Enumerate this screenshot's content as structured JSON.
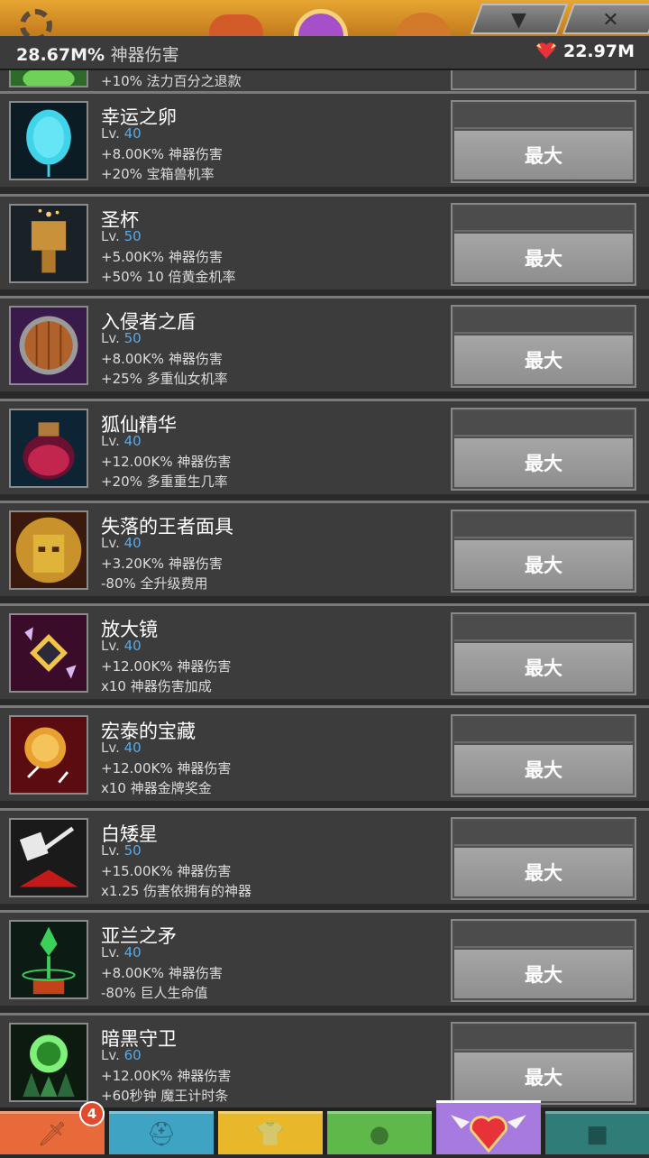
{
  "header": {
    "damage_value": "28.67M%",
    "damage_label": "神器伤害",
    "relics_value": "22.97M"
  },
  "top_tabs": {
    "collapse_icon": "down-triangle-icon",
    "close_icon": "close-icon"
  },
  "partial_row": {
    "effect2": "+10% 法力百分之退款"
  },
  "artifacts": [
    {
      "name": "幸运之卵",
      "lv_label": "Lv.",
      "lv": "40",
      "effect1": "+8.00K% 神器伤害",
      "effect2": "+20% 宝箱兽机率",
      "button": "最大",
      "icon": "egg-icon"
    },
    {
      "name": "圣杯",
      "lv_label": "Lv.",
      "lv": "50",
      "effect1": "+5.00K% 神器伤害",
      "effect2": "+50% 10 倍黄金机率",
      "button": "最大",
      "icon": "grail-icon"
    },
    {
      "name": "入侵者之盾",
      "lv_label": "Lv.",
      "lv": "50",
      "effect1": "+8.00K% 神器伤害",
      "effect2": "+25% 多重仙女机率",
      "button": "最大",
      "icon": "shield-icon"
    },
    {
      "name": "狐仙精华",
      "lv_label": "Lv.",
      "lv": "40",
      "effect1": "+12.00K% 神器伤害",
      "effect2": "+20% 多重重生几率",
      "button": "最大",
      "icon": "potion-icon"
    },
    {
      "name": "失落的王者面具",
      "lv_label": "Lv.",
      "lv": "40",
      "effect1": "+3.20K% 神器伤害",
      "effect2": "-80% 全升级费用",
      "button": "最大",
      "icon": "mask-icon"
    },
    {
      "name": "放大镜",
      "lv_label": "Lv.",
      "lv": "40",
      "effect1": "+12.00K% 神器伤害",
      "effect2": "x10 神器伤害加成",
      "button": "最大",
      "icon": "gem-icon"
    },
    {
      "name": "宏泰的宝藏",
      "lv_label": "Lv.",
      "lv": "40",
      "effect1": "+12.00K% 神器伤害",
      "effect2": "x10 神器金牌奖金",
      "button": "最大",
      "icon": "coin-icon"
    },
    {
      "name": "白矮星",
      "lv_label": "Lv.",
      "lv": "50",
      "effect1": "+15.00K% 神器伤害",
      "effect2": "x1.25 伤害依拥有的神器",
      "button": "最大",
      "icon": "hammer-icon"
    },
    {
      "name": "亚兰之矛",
      "lv_label": "Lv.",
      "lv": "40",
      "effect1": "+8.00K% 神器伤害",
      "effect2": "-80% 巨人生命值",
      "button": "最大",
      "icon": "spear-icon"
    },
    {
      "name": "暗黑守卫",
      "lv_label": "Lv.",
      "lv": "60",
      "effect1": "+12.00K% 神器伤害",
      "effect2": "+60秒钟 魔王计时条",
      "button": "最大",
      "icon": "guardian-icon"
    }
  ],
  "bottom_nav": {
    "badge": "4",
    "tabs": [
      {
        "icon": "sword-icon",
        "color": "#e86a3a"
      },
      {
        "icon": "viking-helmet-icon",
        "color": "#3fa3c4"
      },
      {
        "icon": "armor-icon",
        "color": "#e8b82a"
      },
      {
        "icon": "pet-icon",
        "color": "#5fb84a"
      },
      {
        "icon": "winged-heart-icon",
        "color": "#a67adf"
      },
      {
        "icon": "shop-icon",
        "color": "#2f7c78"
      }
    ]
  }
}
